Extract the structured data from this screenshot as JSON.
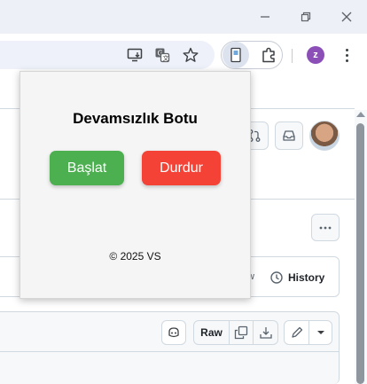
{
  "colors": {
    "start_button": "#4caf50",
    "stop_button": "#f44336",
    "popup_background": "#f5f5f5",
    "profile_avatar": "#8b4fb7"
  },
  "browser": {
    "profile_initial": "z",
    "icons": [
      "minimize-icon",
      "restore-icon",
      "close-icon",
      "install-app-icon",
      "translate-icon",
      "bookmark-star-icon",
      "extension-active-icon",
      "extensions-puzzle-icon",
      "menu-kebab-icon"
    ]
  },
  "page": {
    "history_label": "History",
    "raw_label": "Raw",
    "partial_text": "w"
  },
  "popup": {
    "title": "Devamsızlık Botu",
    "start_label": "Başlat",
    "stop_label": "Durdur",
    "footer": "© 2025 VS"
  }
}
